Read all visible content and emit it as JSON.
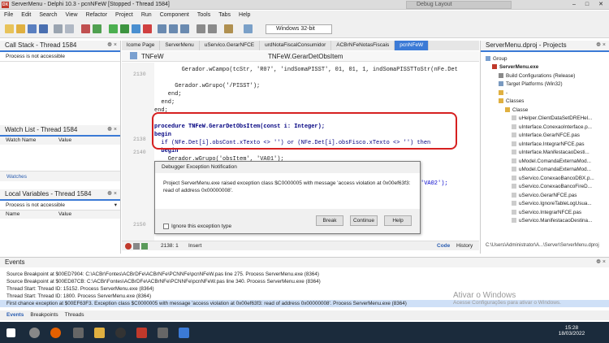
{
  "window": {
    "title": "ServerMenu - Delphi 10.3 - pcnNFeW [Stopped - Thread 1584]",
    "layout": "Debug Layout",
    "logo_text": "DX",
    "minimize": "–",
    "maximize": "□",
    "close": "✕"
  },
  "menu": [
    "File",
    "Edit",
    "Search",
    "View",
    "Refactor",
    "Project",
    "Run",
    "Component",
    "Tools",
    "Tabs",
    "Help"
  ],
  "toolbar": {
    "platform": "Windows 32-bit"
  },
  "callstack": {
    "title": "Call Stack - Thread 1584",
    "pin": "❁ ×",
    "row": "Process is not accessible"
  },
  "watch": {
    "title": "Watch List - Thread 1584",
    "pin": "❁ ×",
    "col_name": "Watch Name",
    "col_value": "Value",
    "tab": "Watches"
  },
  "locals": {
    "title": "Local Variables - Thread 1584",
    "pin": "❁ ×",
    "row": "Process is not accessible",
    "col_name": "Name",
    "col_value": "Value"
  },
  "editor": {
    "tabs": [
      "lcome Page",
      "ServerMenu",
      "uServico.GerarNFCE",
      "urdNotaFiscalConsumidor",
      "ACBrNFeNotasFiscais",
      "pcnNFeW"
    ],
    "unit_left": "TNFeW",
    "unit_right": "TNFeW.GerarDetObsItem",
    "line_numbers": [
      "2130",
      "2138",
      "2140",
      "2150"
    ],
    "code_lines": [
      "        Gerador.wCampo(tcStr, 'R07', 'indSomaPISST', 01, 01, 1, indSomaPISSTToStr(nFe.Det",
      "",
      "      Gerador.wGrupo('/PISST');",
      "    end;",
      "  end;",
      "end;",
      "",
      "procedure TNFeW.GerarDetObsItem(const i: Integer);",
      "begin",
      "  if (NFe.Det[i].obsCont.xTexto <> '') or (NFe.Det[i].obsFisco.xTexto <> '') then",
      "  begin",
      "    Gerador.wGrupo('obsItem', 'VA01');"
    ],
    "code_tail": "'VA02');",
    "status_pos": "2138:  1",
    "status_mode": "Insert",
    "tab_code": "Code",
    "tab_history": "History"
  },
  "dialog": {
    "title": "Debugger Exception Notification",
    "message": "Project ServerMenu.exe raised exception class $C0000005 with message 'access violation at 0x00ef63f3: read of address 0x00000008'.",
    "ignore": "Ignore this exception type",
    "break": "Break",
    "continue": "Continue",
    "help": "Help"
  },
  "projects": {
    "title": "ServerMenu.dproj - Projects",
    "pin": "❁ ×",
    "items": [
      "Group",
      "ServerMenu.exe",
      "Build Configurations (Release)",
      "Target Platforms (Win32)",
      "-",
      "Classes",
      "Classe",
      "uHelper.ClientDataSetDREHel...",
      "uInterface.ConexaoInterface.p...",
      "uInterface.GerarNFCE.pas",
      "uInterface.IntegrarNFCE.pas",
      "uInterface.ManifestacaoDesti...",
      "uModel.ComandaExternaMod...",
      "uModel.ComandaExternaMod...",
      "uServico.ConexaoBancoDBX.p...",
      "uServico.ConexaoBancoFireD...",
      "uServico.GerarNFCE.pas",
      "uServico.IgnoreTableLogUsua...",
      "uServico.IntegrarNFCE.pas",
      "uServico.ManifestacaoDestina..."
    ],
    "path": "C:\\Users\\Administrator\\A...\\Server\\ServerMenu.dproj"
  },
  "events": {
    "title": "Events",
    "pin": "❁ ×",
    "lines": [
      "Source Breakpoint at $00ED7904: C:\\ACBr\\Fontes\\ACBrDFe\\ACBrNFe\\PCNNFe\\pcnNFeW.pas line 275. Process ServerMenu.exe (8364)",
      "Source Breakpoint at $00ED87CB: C:\\ACBr\\Fontes\\ACBrDFe\\ACBrNFe\\PCNNFe\\pcnNFeW.pas line 340. Process ServerMenu.exe (8364)",
      "Thread Start: Thread ID: 15152. Process ServerMenu.exe (8364)",
      "Thread Start: Thread ID: 1800. Process ServerMenu.exe (8364)",
      "First chance exception at $00EF63F3. Exception class $C0000005 with message 'access violation at 0x00ef63f3: read of address 0x00000008'. Process ServerMenu.exe (8364)"
    ],
    "tabs": [
      "Events",
      "Breakpoints",
      "Threads"
    ]
  },
  "watermark": {
    "line1": "Ativar o Windows",
    "line2": "Acesse Configurações para ativar o Windows."
  },
  "taskbar": {
    "time": "15:28",
    "date": "18/03/2022"
  },
  "colors": {
    "accent": "#3b7ad6",
    "highlight_box": "#d62020",
    "taskbar": "#1b2b3c"
  }
}
